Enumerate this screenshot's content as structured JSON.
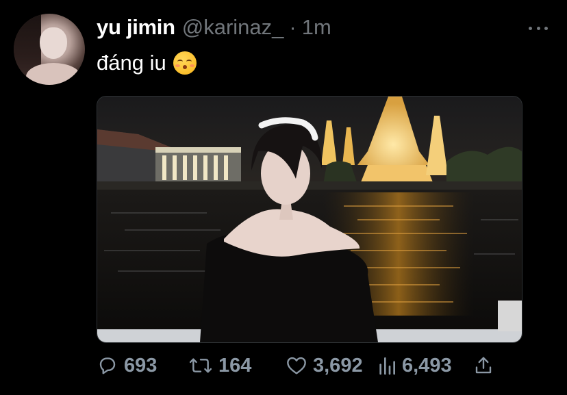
{
  "tweet": {
    "display_name": "yu jimin",
    "handle": "@karinaz_",
    "separator": "·",
    "time": "1m",
    "text": "đáng iu",
    "emoji": "kissing-face-with-closed-eyes"
  },
  "actions": {
    "replies": "693",
    "retweets": "164",
    "likes": "3,692",
    "views": "6,493"
  },
  "colors": {
    "background": "#000000",
    "primary_text": "#ffffff",
    "secondary_text": "#71767b",
    "action_text": "#8b98a5"
  },
  "icons": {
    "more": "more-horizontal-icon",
    "reply": "reply-icon",
    "retweet": "retweet-icon",
    "like": "heart-icon",
    "views": "views-bar-chart-icon",
    "share": "share-icon"
  }
}
